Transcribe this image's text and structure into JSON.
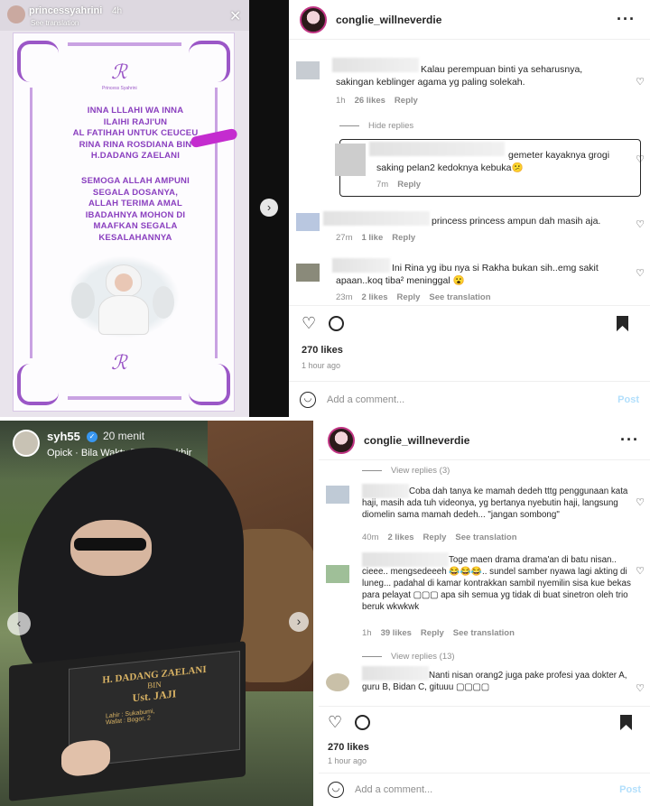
{
  "story1": {
    "username": "princessyahrini",
    "time": "4h",
    "see_translation": "See translation",
    "logo_caption": "Princess Syahrini",
    "text_block1": [
      "INNA LLLAHI WA INNA",
      "ILAIHI RAJI'UN",
      "AL FATIHAH UNTUK CEUCEU",
      "RINA RINA ROSDIANA BIN",
      "H.DADANG ZAELANI"
    ],
    "text_block2": [
      "SEMOGA ALLAH AMPUNI",
      "SEGALA DOSANYA,",
      "ALLAH TERIMA AMAL",
      "IBADAHNYA MOHON DI",
      "MAAFKAN SEGALA",
      "KESALAHANNYA"
    ],
    "close": "✕"
  },
  "panel1": {
    "username": "conglie_willneverdie",
    "comments": [
      {
        "text": "Kalau perempuan binti ya seharusnya, sakingan keblinger agama yg paling solekah.",
        "time": "1h",
        "likes": "26 likes",
        "reply": "Reply"
      },
      {
        "text": "gemeter kayaknya grogi saking pelan2 kedoknya kebuka😕",
        "time": "7m",
        "reply": "Reply"
      },
      {
        "text": "princess princess ampun dah masih aja.",
        "time": "27m",
        "likes": "1 like",
        "reply": "Reply"
      },
      {
        "text": "Ini Rina yg ibu nya si Rakha bukan sih..emg sakit apaan..koq tiba² meninggal 😮",
        "time": "23m",
        "likes": "2 likes",
        "reply": "Reply",
        "see_translation": "See translation"
      }
    ],
    "hide_replies": "Hide replies",
    "likes": "270 likes",
    "ago": "1 hour ago",
    "add_comment": "Add a comment...",
    "post": "Post"
  },
  "story2": {
    "username": "syh55",
    "time": "20 menit",
    "music": "Opick · Bila Waktu T'lah Berakhir",
    "gravestone_name": "H. DADANG ZAELANI",
    "gravestone_bin": "BIN",
    "gravestone_sub": "Ust. JAJI",
    "gravestone_lahir": "Lahir : Sukabumi,",
    "gravestone_wafat": "Wafat : Bogor, 2"
  },
  "panel2": {
    "username": "conglie_willneverdie",
    "view_replies_top": "View replies (3)",
    "comments": [
      {
        "text": "Coba dah tanya ke mamah dedeh tttg penggunaan kata haji, masih ada tuh videonya, yg bertanya nyebutin haji, langsung diomelin sama mamah dedeh... \"jangan sombong\"",
        "time": "40m",
        "likes": "2 likes",
        "reply": "Reply",
        "see_translation": "See translation"
      },
      {
        "text": "Toge maen drama drama'an di batu nisan.. cieee.. mengsedeeeh 😂😂😂.. sundel samber nyawa lagi akting di luneg... padahal di kamar kontrakkan sambil nyemilin sisa kue bekas para pelayat ▢▢▢ apa sih semua yg tidak di buat sinetron oleh trio beruk wkwkwk",
        "time": "1h",
        "likes": "39 likes",
        "reply": "Reply",
        "see_translation": "See translation"
      },
      {
        "text": "Nanti nisan orang2 juga pake profesi yaa dokter A, guru B, Bidan C, gituuu ▢▢▢▢"
      }
    ],
    "view_replies_mid": "View replies (13)",
    "likes": "270 likes",
    "ago": "1 hour ago",
    "add_comment": "Add a comment...",
    "post": "Post"
  }
}
